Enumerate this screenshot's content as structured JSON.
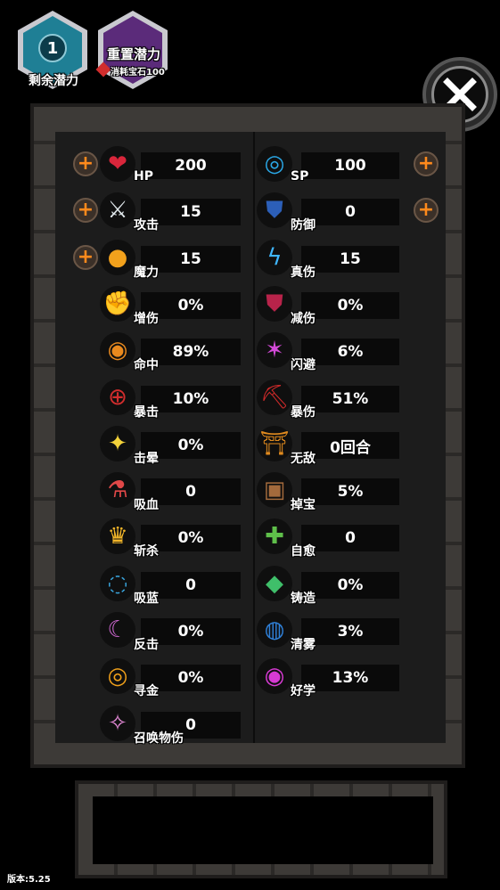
{
  "badges": {
    "remaining": {
      "value": "1",
      "label": "剩余潜力",
      "color": "#1f7f95"
    },
    "reset": {
      "title": "重置潜力",
      "cost": "消耗宝石100",
      "color": "#5b2b7a"
    }
  },
  "close": {
    "icon": "close-icon"
  },
  "stats": {
    "left": [
      {
        "label": "HP",
        "value": "200",
        "icon": "heart-icon",
        "glyph": "❤",
        "color": "#d9263b",
        "plus": true
      },
      {
        "label": "攻击",
        "value": "15",
        "icon": "crossed-swords-icon",
        "glyph": "⚔",
        "color": "#dfe6ea",
        "plus": true
      },
      {
        "label": "魔力",
        "value": "15",
        "icon": "magic-orb-icon",
        "glyph": "●",
        "color": "#f2a11c",
        "plus": true
      },
      {
        "label": "增伤",
        "value": "0%",
        "icon": "fist-icon",
        "glyph": "✊",
        "color": "#c9302c",
        "plus": false
      },
      {
        "label": "命中",
        "value": "89%",
        "icon": "eye-icon",
        "glyph": "◉",
        "color": "#e8891e",
        "plus": false
      },
      {
        "label": "暴击",
        "value": "10%",
        "icon": "crosshair-icon",
        "glyph": "⊕",
        "color": "#d12d2d",
        "plus": false
      },
      {
        "label": "击晕",
        "value": "0%",
        "icon": "stun-stars-icon",
        "glyph": "✦",
        "color": "#f3d23a",
        "plus": false
      },
      {
        "label": "吸血",
        "value": "0",
        "icon": "blood-vial-icon",
        "glyph": "⚗",
        "color": "#e04848",
        "plus": false
      },
      {
        "label": "斩杀",
        "value": "0%",
        "icon": "crown-slash-icon",
        "glyph": "♛",
        "color": "#f3b629",
        "plus": false
      },
      {
        "label": "吸蓝",
        "value": "0",
        "icon": "bubbles-icon",
        "glyph": "◌",
        "color": "#3aa7e0",
        "plus": false
      },
      {
        "label": "反击",
        "value": "0%",
        "icon": "crescent-slash-icon",
        "glyph": "☾",
        "color": "#d36ad6",
        "plus": false
      },
      {
        "label": "寻金",
        "value": "0%",
        "icon": "gold-coin-icon",
        "glyph": "◎",
        "color": "#f0a01a",
        "plus": false
      },
      {
        "label": "召唤物伤",
        "value": "0",
        "icon": "summon-claw-icon",
        "glyph": "✧",
        "color": "#e58ad8",
        "plus": false
      }
    ],
    "right": [
      {
        "label": "SP",
        "value": "100",
        "icon": "swirl-icon",
        "glyph": "◎",
        "color": "#2aa7e6",
        "plus": true
      },
      {
        "label": "防御",
        "value": "0",
        "icon": "shield-icon",
        "glyph": "⛊",
        "color": "#2c5fb8",
        "plus": true
      },
      {
        "label": "真伤",
        "value": "15",
        "icon": "lightning-icon",
        "glyph": "ϟ",
        "color": "#3fb6ff",
        "plus": false
      },
      {
        "label": "减伤",
        "value": "0%",
        "icon": "red-shield-icon",
        "glyph": "⛊",
        "color": "#b8234a",
        "plus": false
      },
      {
        "label": "闪避",
        "value": "6%",
        "icon": "dodge-figure-icon",
        "glyph": "✶",
        "color": "#d34ad8",
        "plus": false
      },
      {
        "label": "暴伤",
        "value": "51%",
        "icon": "pickaxe-icon",
        "glyph": "⛏",
        "color": "#d32a2a",
        "plus": false
      },
      {
        "label": "无敌",
        "value": "0回合",
        "icon": "gate-icon",
        "glyph": "⛩",
        "color": "#e08a1e",
        "plus": false
      },
      {
        "label": "掉宝",
        "value": "5%",
        "icon": "treasure-chest-icon",
        "glyph": "▣",
        "color": "#a36a3c",
        "plus": false
      },
      {
        "label": "自愈",
        "value": "0",
        "icon": "healing-hand-icon",
        "glyph": "✚",
        "color": "#5fbf4a",
        "plus": false
      },
      {
        "label": "铸造",
        "value": "0%",
        "icon": "green-diamond-icon",
        "glyph": "◆",
        "color": "#3fbf6a",
        "plus": false
      },
      {
        "label": "清雾",
        "value": "3%",
        "icon": "fog-orb-icon",
        "glyph": "◍",
        "color": "#2f7fd6",
        "plus": false
      },
      {
        "label": "好学",
        "value": "13%",
        "icon": "learning-orb-icon",
        "glyph": "◉",
        "color": "#d73ad3",
        "plus": false
      }
    ]
  },
  "footer": {
    "version": "版本:5.25"
  }
}
